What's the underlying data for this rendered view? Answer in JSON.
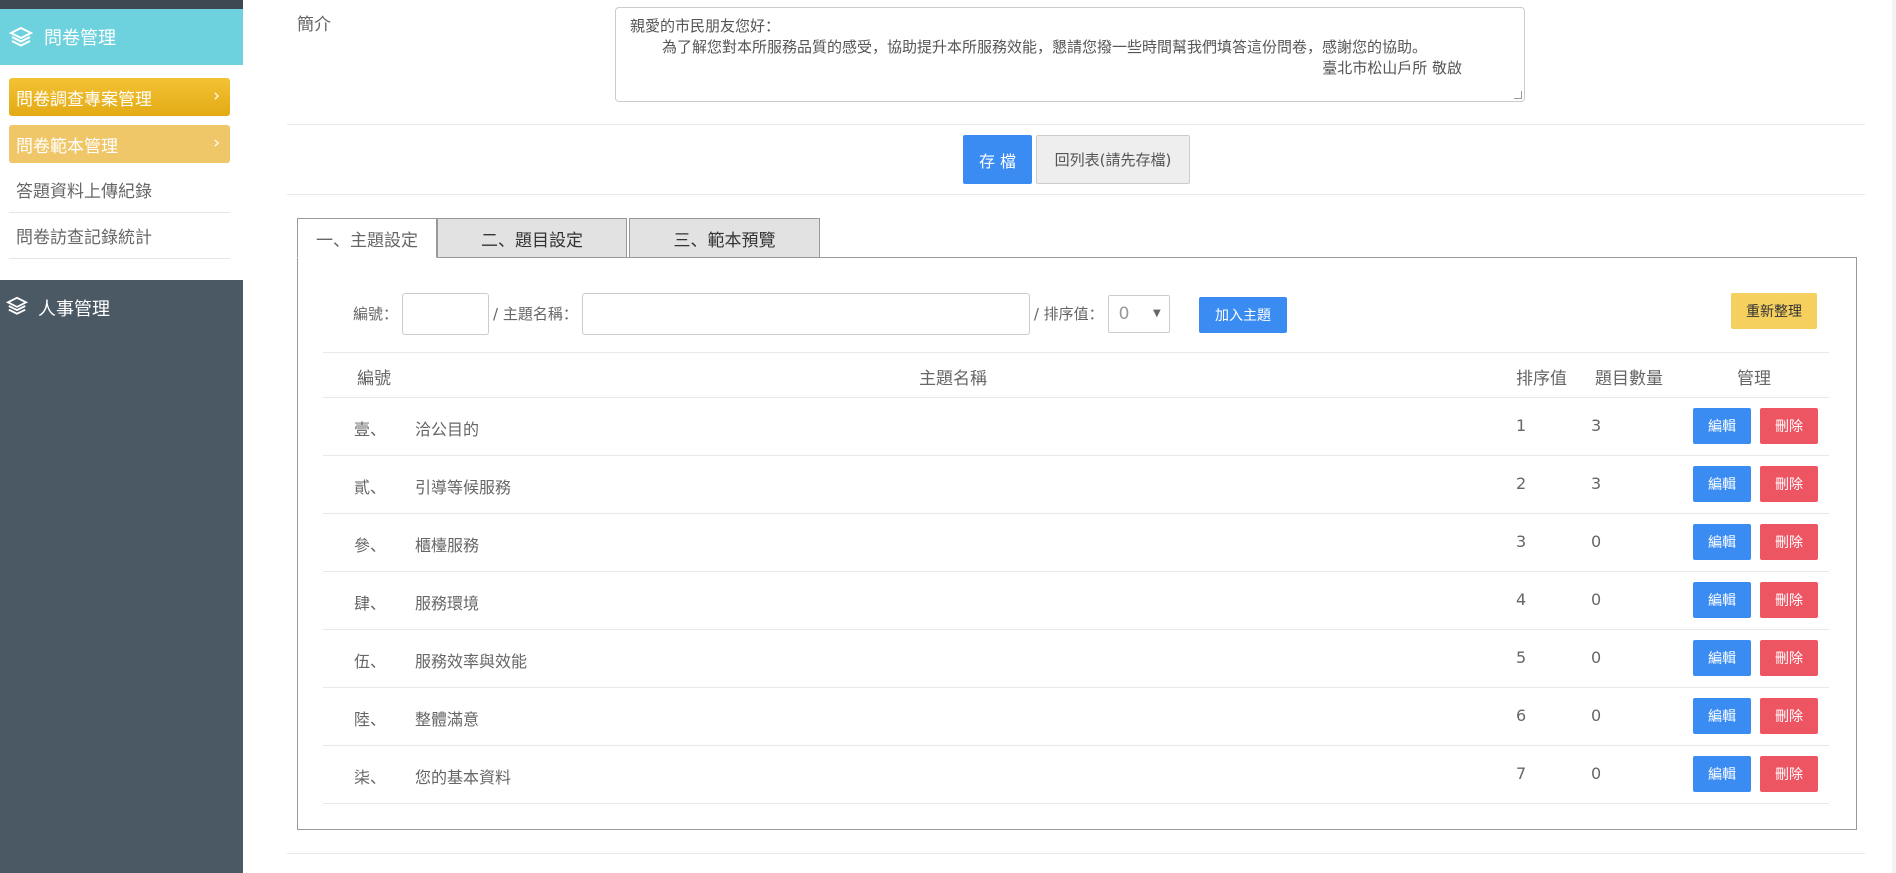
{
  "sidebar": {
    "section_title": "問卷管理",
    "section_icon": "layers-icon",
    "items": [
      {
        "label": "問卷調查專案管理",
        "chevron": "›"
      },
      {
        "label": "問卷範本管理",
        "chevron": "›"
      }
    ],
    "links": [
      {
        "label": "答題資料上傳紀錄"
      },
      {
        "label": "問卷訪查記錄統計"
      }
    ],
    "section2_title": "人事管理",
    "section2_icon": "layers-icon"
  },
  "intro": {
    "label": "簡介",
    "line1": "親愛的市民朋友您好：",
    "line2": "為了解您對本所服務品質的感受，協助提升本所服務效能，懇請您撥一些時間幫我們填答這份問卷，感謝您的協助。",
    "line3": "臺北市松山戶所 敬啟"
  },
  "actions": {
    "save_label": "存 檔",
    "back_label": "回列表(請先存檔)"
  },
  "tabs": [
    {
      "label": "一、主題設定",
      "active": true
    },
    {
      "label": "二、題目設定",
      "active": false
    },
    {
      "label": "三、範本預覽",
      "active": false
    }
  ],
  "form": {
    "code_label": "編號：",
    "name_label": "/ 主題名稱：",
    "order_label": "/ 排序值：",
    "order_value": "0",
    "add_label": "加入主題",
    "reorg_label": "重新整理"
  },
  "table": {
    "headers": {
      "code": "編號",
      "name": "主題名稱",
      "order": "排序值",
      "count": "題目數量",
      "manage": "管理"
    },
    "edit_label": "編輯",
    "delete_label": "刪除",
    "rows": [
      {
        "code": "壹、",
        "name": "洽公目的",
        "order": "1",
        "count": "3"
      },
      {
        "code": "貳、",
        "name": "引導等候服務",
        "order": "2",
        "count": "3"
      },
      {
        "code": "參、",
        "name": "櫃檯服務",
        "order": "3",
        "count": "0"
      },
      {
        "code": "肆、",
        "name": "服務環境",
        "order": "4",
        "count": "0"
      },
      {
        "code": "伍、",
        "name": "服務效率與效能",
        "order": "5",
        "count": "0"
      },
      {
        "code": "陸、",
        "name": "整體滿意",
        "order": "6",
        "count": "0"
      },
      {
        "code": "柒、",
        "name": "您的基本資料",
        "order": "7",
        "count": "0"
      }
    ]
  },
  "colors": {
    "sidebar_bg": "#4b5965",
    "section_accent": "#6dd2dd",
    "primary": "#3a8cf2",
    "danger": "#ee5563",
    "warning": "#f6d05e"
  }
}
